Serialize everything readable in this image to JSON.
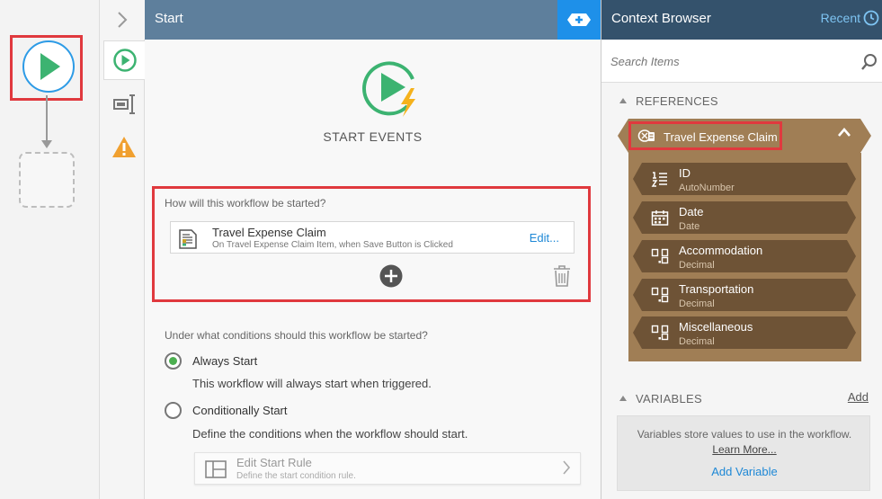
{
  "canvas": {
    "start_node": "play-icon",
    "placeholder": "empty-step"
  },
  "strip": {
    "collapse_icon": "chevron-right-icon",
    "tabs": [
      "play-icon",
      "properties-icon",
      "warning-icon"
    ]
  },
  "main": {
    "title": "Start",
    "hero_label": "START EVENTS",
    "question_start": "How will this workflow be started?",
    "trigger": {
      "title": "Travel Expense Claim",
      "subtitle": "On Travel Expense Claim Item, when Save Button is Clicked",
      "edit": "Edit..."
    },
    "question_conditions": "Under what conditions should this workflow be started?",
    "options": [
      {
        "label": "Always Start",
        "desc": "This workflow will always start when triggered.",
        "selected": true
      },
      {
        "label": "Conditionally Start",
        "desc": "Define the conditions when the workflow should start.",
        "selected": false
      }
    ],
    "rule": {
      "title": "Edit Start Rule",
      "subtitle": "Define the start condition rule."
    }
  },
  "context": {
    "title": "Context Browser",
    "recent": "Recent",
    "search_placeholder": "Search Items",
    "references_label": "REFERENCES",
    "reference": {
      "name": "Travel Expense Claim",
      "fields": [
        {
          "name": "ID",
          "type": "AutoNumber",
          "icon": "autonumber-icon"
        },
        {
          "name": "Date",
          "type": "Date",
          "icon": "calendar-icon"
        },
        {
          "name": "Accommodation",
          "type": "Decimal",
          "icon": "decimal-icon"
        },
        {
          "name": "Transportation",
          "type": "Decimal",
          "icon": "decimal-icon"
        },
        {
          "name": "Miscellaneous",
          "type": "Decimal",
          "icon": "decimal-icon"
        }
      ]
    },
    "variables_label": "VARIABLES",
    "variables_add": "Add",
    "variables_desc": "Variables store values to use in the workflow.",
    "learn_more": "Learn More...",
    "add_variable": "Add Variable"
  },
  "colors": {
    "main_header": "#5e7f9c",
    "context_header": "#34526c",
    "accent_blue": "#1e90e9",
    "start_green": "#3cb371",
    "reference_brown": "#a07e55",
    "field_brown": "#6e5336",
    "highlight_red": "#e0393e"
  }
}
